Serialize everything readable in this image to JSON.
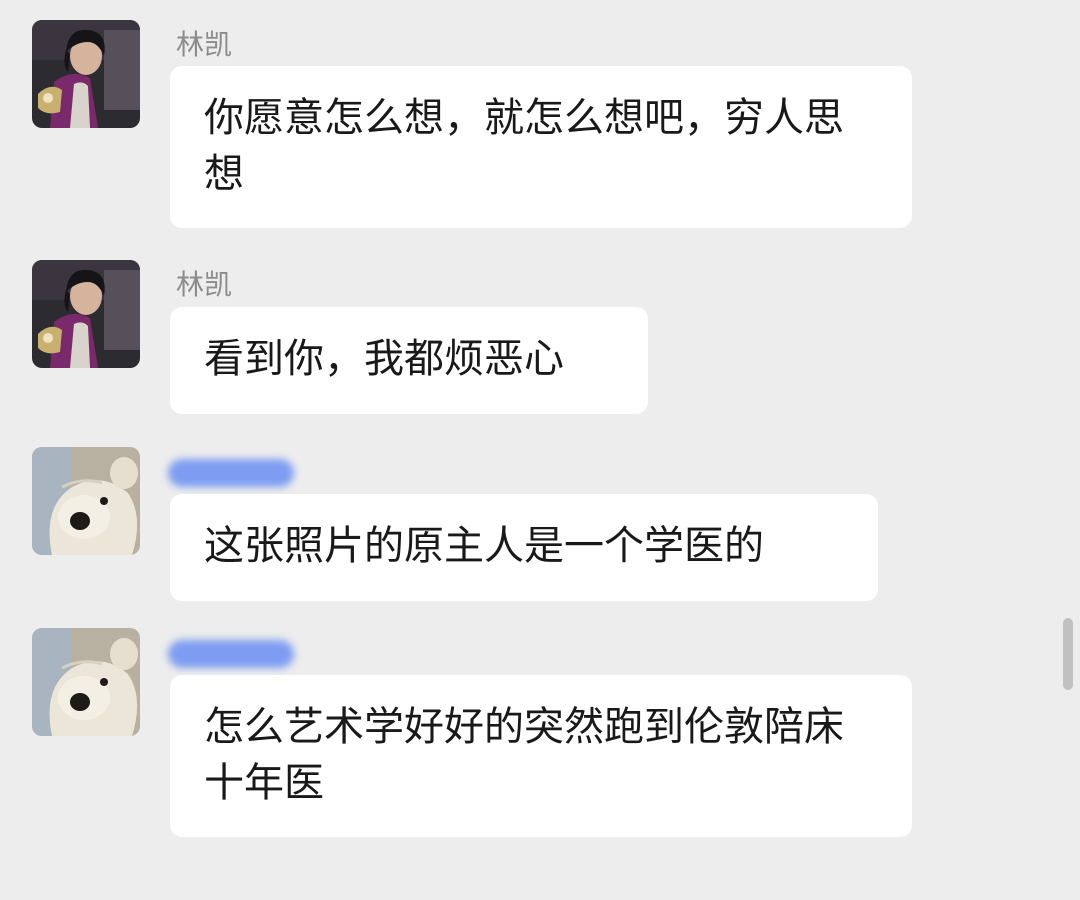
{
  "messages": [
    {
      "sender": "林凯",
      "sender_redacted": false,
      "avatar_icon": "person-photo-avatar",
      "text": "你愿意怎么想，就怎么想吧，穷人思想"
    },
    {
      "sender": "林凯",
      "sender_redacted": false,
      "avatar_icon": "person-photo-avatar",
      "text": "看到你，我都烦恶心"
    },
    {
      "sender": "",
      "sender_redacted": true,
      "avatar_icon": "teddy-bear-avatar",
      "text": "这张照片的原主人是一个学医的"
    },
    {
      "sender": "",
      "sender_redacted": true,
      "avatar_icon": "teddy-bear-avatar",
      "text": "怎么艺术学好好的突然跑到伦敦陪床十年医"
    }
  ],
  "colors": {
    "background": "#ededed",
    "bubble": "#ffffff",
    "redaction": "#7d9cf2"
  }
}
